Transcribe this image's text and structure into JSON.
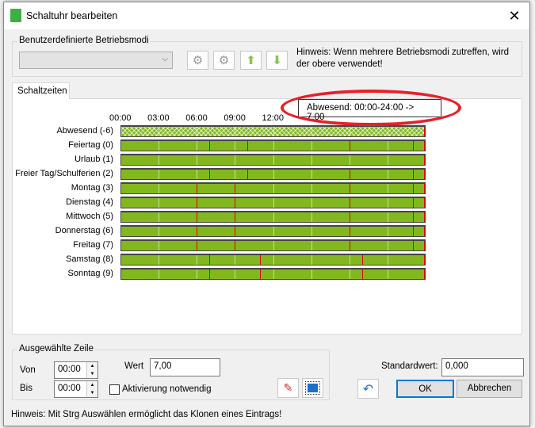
{
  "window": {
    "title": "Schaltuhr bearbeiten",
    "close_icon": "close-icon"
  },
  "modes": {
    "group_label": "Benutzerdefinierte Betriebsmodi",
    "selected": "",
    "hint": "Hinweis: Wenn mehrere Betriebsmodi zutreffen, wird der obere verwendet!",
    "buttons": [
      "add-clock-icon",
      "remove-clock-icon",
      "arrow-up-icon",
      "arrow-down-icon"
    ]
  },
  "tab": {
    "label": "Schaltzeiten"
  },
  "schedule": {
    "time_labels": [
      "00:00",
      "03:00",
      "06:00",
      "09:00",
      "12:00"
    ],
    "tooltip": "Abwesend: 00:00-24:00 -> 7,00",
    "rows": [
      {
        "label": "Abwesend (-6)",
        "switches": [],
        "hatched": true
      },
      {
        "label": "Feiertag (0)",
        "switches": [
          7,
          10,
          18,
          23
        ]
      },
      {
        "label": "Urlaub (1)",
        "switches": []
      },
      {
        "label": "Freier Tag/Schulferien (2)",
        "switches": [
          7,
          10,
          18,
          23
        ]
      },
      {
        "label": "Montag (3)",
        "switches": [
          6,
          9,
          18,
          23
        ]
      },
      {
        "label": "Dienstag (4)",
        "switches": [
          6,
          9,
          18,
          23
        ]
      },
      {
        "label": "Mittwoch (5)",
        "switches": [
          6,
          9,
          18,
          23
        ]
      },
      {
        "label": "Donnerstag (6)",
        "switches": [
          6,
          9,
          18,
          23
        ]
      },
      {
        "label": "Freitag (7)",
        "switches": [
          6,
          9,
          18,
          23
        ]
      },
      {
        "label": "Samstag (8)",
        "switches": [
          7,
          11,
          19
        ]
      },
      {
        "label": "Sonntag (9)",
        "switches": [
          7,
          11,
          19
        ]
      }
    ],
    "colors": {
      "bar": "#82b81e",
      "switch": "#e00000",
      "highlight": "#e8202a"
    }
  },
  "selected_row": {
    "group_label": "Ausgewählte Zeile",
    "von_label": "Von",
    "von": "00:00",
    "bis_label": "Bis",
    "bis": "00:00",
    "wert_label": "Wert",
    "wert": "7,00",
    "activation_label": "Aktivierung notwendig",
    "activation_checked": false
  },
  "footer": {
    "standard_label": "Standardwert:",
    "standard_value": "0,000",
    "ok": "OK",
    "cancel": "Abbrechen",
    "hint": "Hinweis: Mit Strg Auswählen ermöglicht das Klonen eines Eintrags!"
  }
}
